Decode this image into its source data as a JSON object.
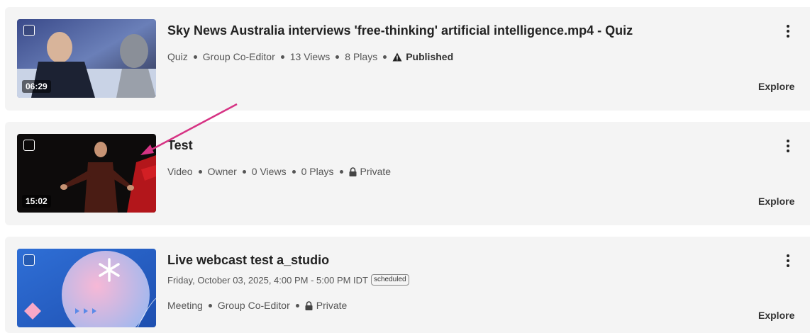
{
  "colors": {
    "annotation_arrow": "#d63384",
    "card_background": "#f4f4f4"
  },
  "entries": [
    {
      "title": "Sky News Australia interviews 'free-thinking' artificial intelligence.mp4 - Quiz",
      "duration": "06:29",
      "meta": {
        "type": "Quiz",
        "role": "Group Co-Editor",
        "views": "13 Views",
        "plays": "8 Plays",
        "status": "Published",
        "status_icon": "warning-icon"
      },
      "explore_label": "Explore"
    },
    {
      "title": "Test",
      "duration": "15:02",
      "meta": {
        "type": "Video",
        "role": "Owner",
        "views": "0 Views",
        "plays": "0 Plays",
        "status": "Private",
        "status_icon": "lock-icon"
      },
      "explore_label": "Explore"
    },
    {
      "title": "Live webcast test a_studio",
      "date": "Friday, October 03, 2025, 4:00 PM - 5:00 PM IDT",
      "badge": "scheduled",
      "meta": {
        "type": "Meeting",
        "role": "Group Co-Editor",
        "status": "Private",
        "status_icon": "lock-icon"
      },
      "explore_label": "Explore"
    }
  ]
}
